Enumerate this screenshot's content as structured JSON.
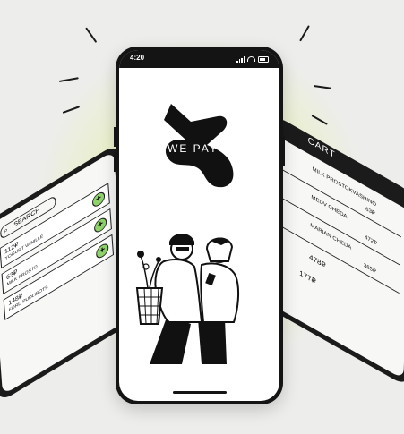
{
  "left_phone": {
    "search_label": "SEARCH",
    "items": [
      {
        "name": "YOGURT VANILLE",
        "price": "112₽"
      },
      {
        "name": "MILK PROSTO",
        "price": "63₽"
      },
      {
        "name": "FORD PUDLIBOTS",
        "price": "148₽"
      }
    ]
  },
  "right_phone": {
    "title": "CART",
    "items": [
      {
        "name": "MILK PROSTOKVASHINO",
        "price": "63₽"
      },
      {
        "name": "MEDV CHEDA",
        "price": "472₽"
      },
      {
        "name": "MARIAN CHEDA",
        "price": "365₽"
      },
      {
        "name": "",
        "price": "478₽"
      },
      {
        "name": "",
        "price": "177₽"
      }
    ]
  },
  "main_phone": {
    "status_time": "4:20",
    "logo_text": "WE PAY"
  }
}
